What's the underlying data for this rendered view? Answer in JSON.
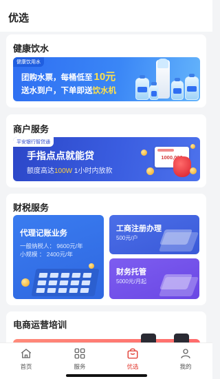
{
  "header": {
    "title": "优选"
  },
  "sections": {
    "water": {
      "title": "健康饮水",
      "banner": {
        "tag": "健康饮用水",
        "line1_pre": "团购水票，每桶低至",
        "line1_price": "10元",
        "line2_pre": "送水到户，下单即送",
        "line2_highlight": "饮水机"
      }
    },
    "merchant": {
      "title": "商户服务",
      "banner": {
        "tag": "平安银行智贷通",
        "line1": "手指点点就能贷",
        "line2_pre": "额度高达",
        "line2_highlight": "100W",
        "line2_post": " 1小时内放款",
        "card_amount": "1000,000"
      }
    },
    "tax": {
      "title": "财税服务",
      "accounting": {
        "title": "代理记账业务",
        "line_a": "一般纳税人：  9600元/年",
        "line_b": "小规模    ：  2400元/年"
      },
      "registration": {
        "title": "工商注册办理",
        "price": "500元/户"
      },
      "trust": {
        "title": "财务托管",
        "price": "5000元/月起"
      }
    },
    "ecom": {
      "title": "电商运营培训"
    }
  },
  "tabbar": {
    "items": [
      {
        "label": "首页",
        "icon": "home-icon"
      },
      {
        "label": "服务",
        "icon": "grid-icon"
      },
      {
        "label": "优选",
        "icon": "bag-icon",
        "active": true
      },
      {
        "label": "我的",
        "icon": "person-icon"
      }
    ]
  },
  "colors": {
    "accent": "#e0352b",
    "blue": "#2f6ff2",
    "purple": "#6a47e4"
  }
}
